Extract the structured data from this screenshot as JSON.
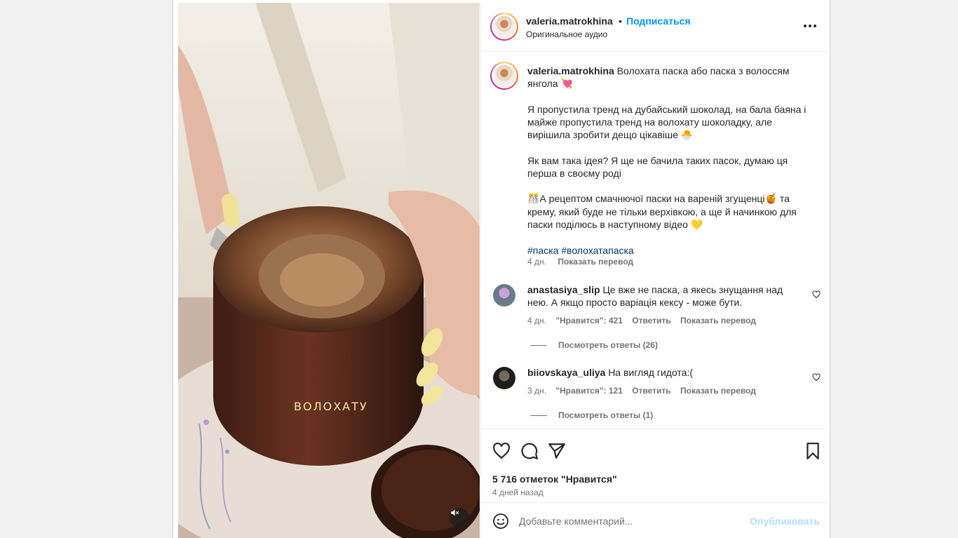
{
  "post": {
    "username": "valeria.matrokhina",
    "dot": "•",
    "follow_label": "Подписаться",
    "audio_label": "Оригинальное аудио",
    "more_icon": "more-horizontal-icon",
    "media_caption": "ВОЛОХАТУ",
    "mute_icon": "speaker-muted-icon"
  },
  "caption": {
    "username": "valeria.matrokhina",
    "title": "Волохата паска або паска з волоссям янгола",
    "title_emoji": "💘",
    "p1": "Я пропустила тренд на дубайський шоколад, на бала баяна і майже пропустила тренд на волохату шоколадку, але вирішила зробити дещо цікавіше",
    "p1_emoji": "🐣",
    "p2": "Як вам така ідея? Я ще не бачила таких пасок, думаю ця перша в своєму роді",
    "p3_emoji_start": "🎊",
    "p3_a": "А рецептом смачнючої паски на вареній згущенці",
    "p3_emoji_mid": "🍯",
    "p3_b": " та крему, який буде не тільки верхівкою, а ще й начинкою для паски поділюсь в наступному відео",
    "p3_emoji_end": "💛",
    "hashtags": "#паска #волохатапаска",
    "time": "4 дн.",
    "translate": "Показать перевод"
  },
  "comments": [
    {
      "username": "anastasiya_slip",
      "text": "Це вже не паска, а якесь знущання над нею. А якщо просто варіація кексу - може бути.",
      "time": "4 дн.",
      "likes": "\"Нравится\": 421",
      "reply": "Ответить",
      "translate": "Показать перевод",
      "view_replies": "Посмотреть ответы (26)"
    },
    {
      "username": "biiovskaya_uliya",
      "text": "На вигляд гидота:(",
      "time": "3 дн.",
      "likes": "\"Нравится\": 121",
      "reply": "Ответить",
      "translate": "Показать перевод",
      "view_replies": "Посмотреть ответы (1)"
    }
  ],
  "actions": {
    "like_icon": "heart-icon",
    "comment_icon": "comment-icon",
    "share_icon": "send-icon",
    "save_icon": "bookmark-icon",
    "likes_count": "5 716 отметок \"Нравится\"",
    "time_ago": "4 дней назад"
  },
  "comment_box": {
    "emoji_icon": "smile-icon",
    "placeholder": "Добавьте комментарий...",
    "publish_label": "Опубликовать"
  },
  "colors": {
    "link_blue": "#0095f6",
    "hashtag_blue": "#00376b",
    "muted_text": "#737373",
    "publish_disabled": "#b2dffc"
  }
}
